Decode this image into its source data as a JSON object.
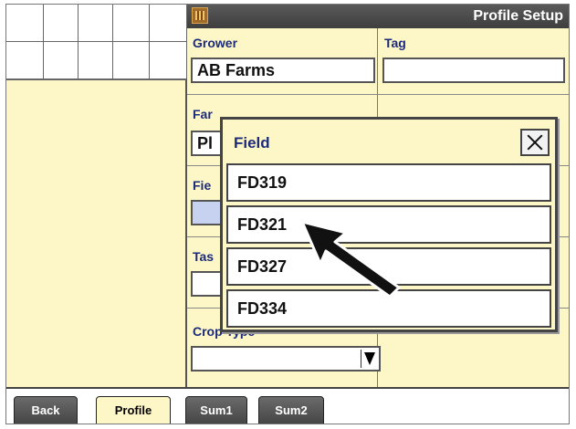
{
  "header": {
    "title": "Profile Setup",
    "icon": "grid-icon"
  },
  "form": {
    "grower_label": "Grower",
    "grower_value": "AB Farms",
    "tag_label": "Tag",
    "tag_value": "",
    "farm_label_partial": "Far",
    "farm_value_partial": "Pl",
    "field_label_partial": "Fie",
    "task_label_partial": "Tas",
    "crop_type_label": "Crop Type",
    "crop_type_value": ""
  },
  "modal": {
    "title": "Field",
    "options": [
      "FD319",
      "FD321",
      "FD327",
      "FD334"
    ]
  },
  "tabs": {
    "back": "Back",
    "profile": "Profile",
    "sum1": "Sum1",
    "sum2": "Sum2"
  },
  "colors": {
    "panel_bg": "#fdf7c8",
    "label_text": "#1c2a7a",
    "selected_field": "#c6d2f0"
  }
}
